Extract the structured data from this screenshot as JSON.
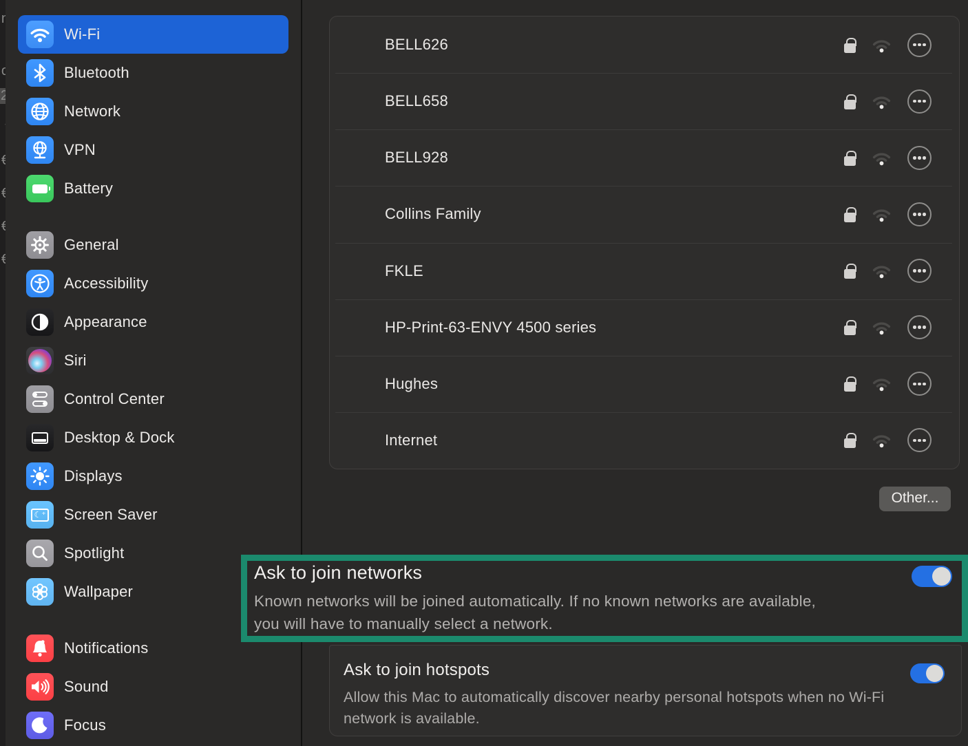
{
  "window": {
    "app": "System Settings",
    "pane": "Wi-Fi"
  },
  "colors": {
    "selection_blue": "#1d63d6",
    "toggle_blue": "#2470e3",
    "annotation_green": "#1b8a6d",
    "panel_background": "#2e2d2c",
    "page_background": "#2a2928"
  },
  "behind_window_fragments": [
    "n",
    "o",
    "2",
    "\\",
    "€",
    "€",
    "€",
    "€"
  ],
  "sidebar": {
    "items": [
      {
        "label": "Wi-Fi",
        "icon": "wifi-icon",
        "color": "#3b8cf4",
        "selected": true,
        "gap_before": false
      },
      {
        "label": "Bluetooth",
        "icon": "bluetooth-icon",
        "color": "#2f86f2",
        "selected": false,
        "gap_before": false
      },
      {
        "label": "Network",
        "icon": "network-globe-icon",
        "color": "#2f86f2",
        "selected": false,
        "gap_before": false
      },
      {
        "label": "VPN",
        "icon": "vpn-globe-icon",
        "color": "#2f86f2",
        "selected": false,
        "gap_before": false
      },
      {
        "label": "Battery",
        "icon": "battery-icon",
        "color": "#3ac75c",
        "selected": false,
        "gap_before": false
      },
      {
        "label": "General",
        "icon": "gear-icon",
        "color": "#8e8d92",
        "selected": false,
        "gap_before": true
      },
      {
        "label": "Accessibility",
        "icon": "accessibility-icon",
        "color": "#2f86f2",
        "selected": false,
        "gap_before": false
      },
      {
        "label": "Appearance",
        "icon": "appearance-icon",
        "color": "#161618",
        "selected": false,
        "gap_before": false
      },
      {
        "label": "Siri",
        "icon": "siri-icon",
        "color": "#2d2d30",
        "selected": false,
        "gap_before": false
      },
      {
        "label": "Control Center",
        "icon": "control-center-icon",
        "color": "#8e8d92",
        "selected": false,
        "gap_before": false
      },
      {
        "label": "Desktop & Dock",
        "icon": "desktop-dock-icon",
        "color": "#161618",
        "selected": false,
        "gap_before": false
      },
      {
        "label": "Displays",
        "icon": "displays-sun-icon",
        "color": "#2f86f2",
        "selected": false,
        "gap_before": false
      },
      {
        "label": "Screen Saver",
        "icon": "screen-saver-icon",
        "color": "#58b2ef",
        "selected": false,
        "gap_before": false
      },
      {
        "label": "Spotlight",
        "icon": "spotlight-magnifier-icon",
        "color": "#97969b",
        "selected": false,
        "gap_before": false
      },
      {
        "label": "Wallpaper",
        "icon": "wallpaper-flower-icon",
        "color": "#60b4f0",
        "selected": false,
        "gap_before": false
      },
      {
        "label": "Notifications",
        "icon": "notifications-bell-icon",
        "color": "#fb4045",
        "selected": false,
        "gap_before": true
      },
      {
        "label": "Sound",
        "icon": "sound-speaker-icon",
        "color": "#fb4045",
        "selected": false,
        "gap_before": false
      },
      {
        "label": "Focus",
        "icon": "focus-moon-icon",
        "color": "#5d5ce5",
        "selected": false,
        "gap_before": false
      }
    ]
  },
  "network_list": {
    "items": [
      {
        "name": "BELL626"
      },
      {
        "name": "BELL658"
      },
      {
        "name": "BELL928"
      },
      {
        "name": "Collins Family"
      },
      {
        "name": "FKLE"
      },
      {
        "name": "HP-Print-63-ENVY 4500 series"
      },
      {
        "name": "Hughes"
      },
      {
        "name": "Internet"
      }
    ],
    "row_icons": [
      "lock-icon",
      "wifi-signal-icon",
      "more-options-button"
    ],
    "other_button_label": "Other..."
  },
  "ask_to_join_networks": {
    "title": "Ask to join networks",
    "description": "Known networks will be joined automatically. If no known networks are available, you will have to manually select a network.",
    "toggle_on": true,
    "annotated": true
  },
  "ask_to_join_hotspots": {
    "title": "Ask to join hotspots",
    "description": "Allow this Mac to automatically discover nearby personal hotspots when no Wi-Fi network is available.",
    "toggle_on": true
  }
}
